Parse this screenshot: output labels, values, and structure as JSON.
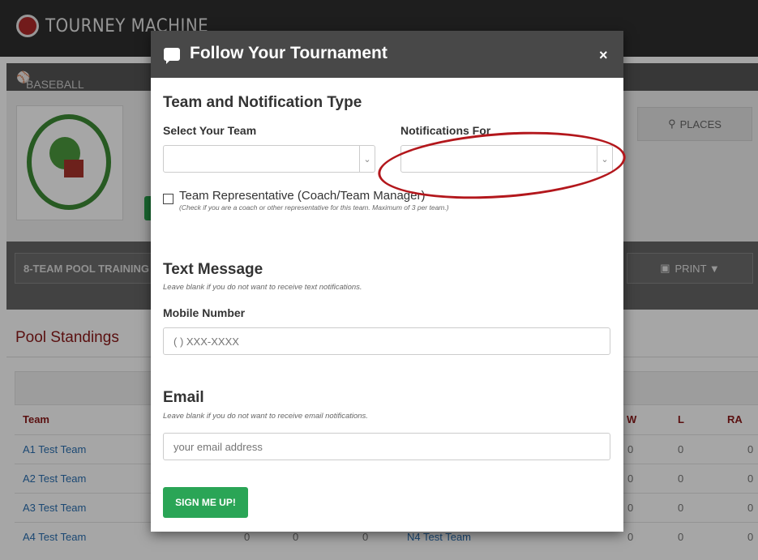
{
  "app": {
    "title": "TOURNEY MACHINE"
  },
  "sport": {
    "label": "BASEBALL"
  },
  "places": {
    "label": "PLACES"
  },
  "tab": {
    "label": "8-TEAM POOL TRAINING"
  },
  "print": {
    "label": "PRINT ▼"
  },
  "standings": {
    "title": "Pool Standings",
    "headers": {
      "team": "Team",
      "w": "W",
      "l": "L",
      "ra": "RA"
    },
    "rows": [
      {
        "team": "A1 Test Team",
        "w": "0",
        "l": "0",
        "ra": "0"
      },
      {
        "team": "A2 Test Team",
        "w": "0",
        "l": "0",
        "ra": "0"
      },
      {
        "team": "A3 Test Team",
        "w": "0",
        "l": "0",
        "ra": "0"
      },
      {
        "team": "A4 Test Team",
        "c1": "0",
        "c2": "0",
        "c3": "0",
        "team2": "N4 Test Team",
        "w": "0",
        "l": "0",
        "ra": "0"
      }
    ]
  },
  "modal": {
    "title": "Follow Your Tournament",
    "close": "×",
    "section1": "Team and Notification Type",
    "select_team_label": "Select Your Team",
    "notifications_label": "Notifications For",
    "rep_label": "Team Representative (Coach/Team Manager)",
    "rep_hint": "(Check if you are a coach or other representative for this team. Maximum of 3 per team.)",
    "text_title": "Text Message",
    "text_hint": "Leave blank if you do not want to receive text notifications.",
    "mobile_label": "Mobile Number",
    "mobile_placeholder": "( ) XXX-XXXX",
    "email_title": "Email",
    "email_hint": "Leave blank if you do not want to receive email notifications.",
    "email_placeholder": "your email address",
    "signup": "SIGN ME UP!"
  },
  "colors": {
    "accent_red": "#8b1a1a",
    "signup_green": "#2aa556",
    "annotation_red": "#b3171c"
  }
}
